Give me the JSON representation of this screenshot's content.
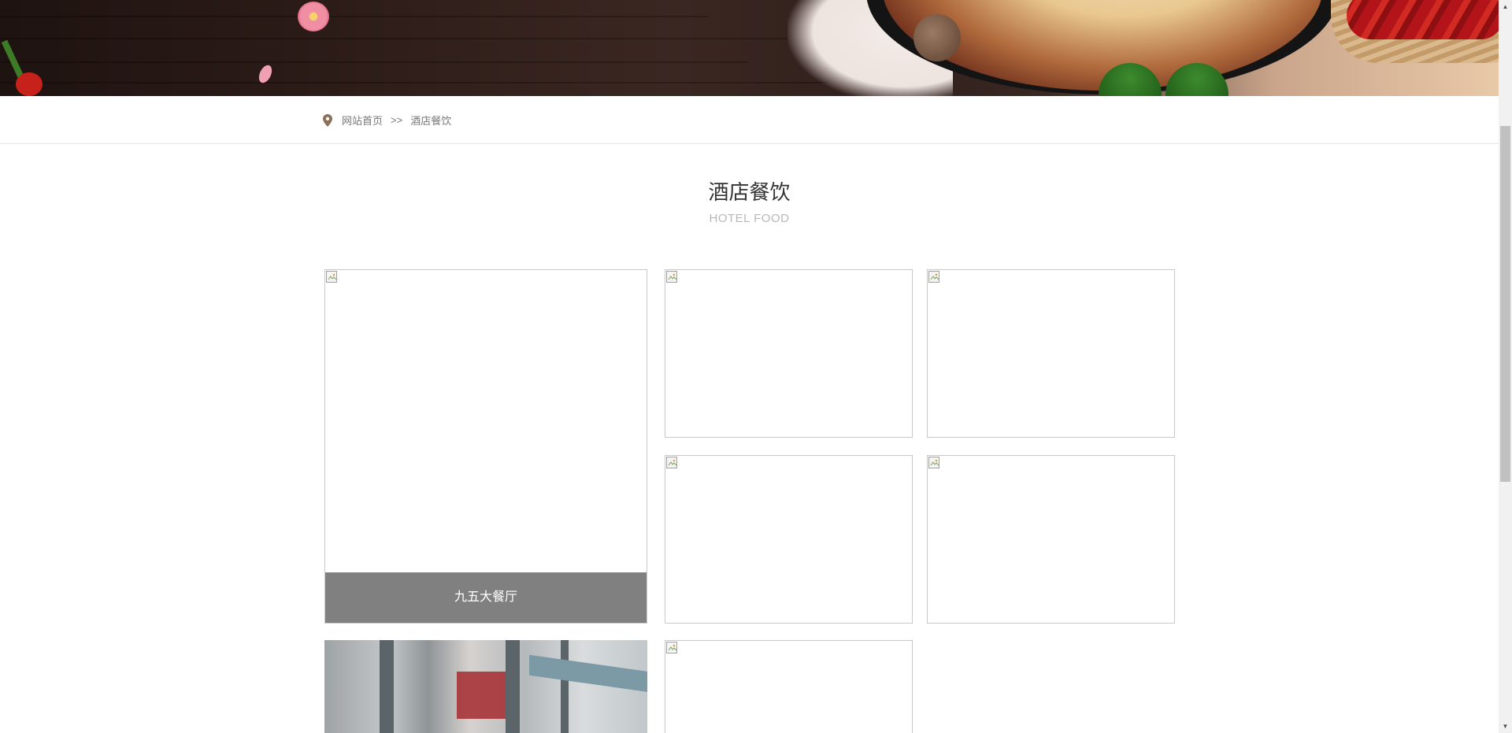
{
  "breadcrumb": {
    "icon": "map-pin-icon",
    "home": "网站首页",
    "separator": ">>",
    "current": "酒店餐饮"
  },
  "section": {
    "title": "酒店餐饮",
    "subtitle": "HOTEL FOOD"
  },
  "gallery": {
    "featured_caption": "九五大餐厅"
  },
  "colors": {
    "caption_bg": "#808080",
    "pin": "#8c6f56",
    "title": "#333333",
    "subtitle": "#b8b8b8"
  },
  "scrollbar": {
    "up_icon": "triangle-up-icon",
    "down_icon": "triangle-down-icon"
  }
}
